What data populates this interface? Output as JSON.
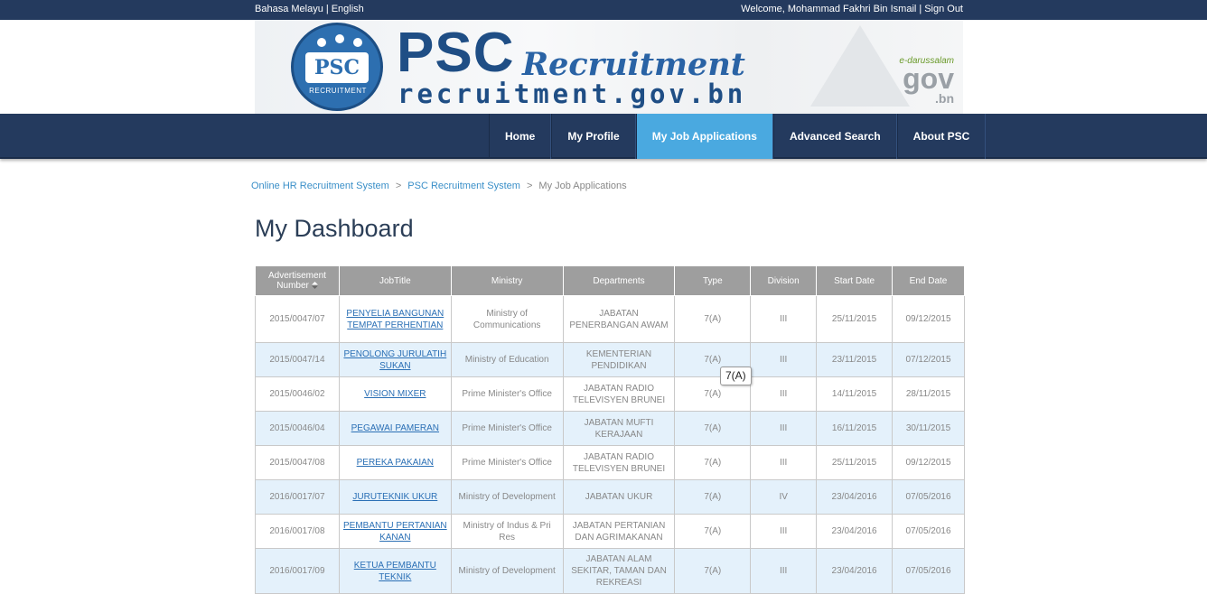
{
  "topbar": {
    "lang_malay": "Bahasa Melayu",
    "lang_english": "English",
    "welcome": "Welcome, Mohammad Fakhri Bin Ismail",
    "sign_out": "Sign Out"
  },
  "banner": {
    "logo_box": "PSC",
    "logo_sub": "RECRUITMENT",
    "title_psc": "PSC",
    "title_recruitment": "Recruitment",
    "url": "recruitment.gov.bn",
    "gov_ed": "e-darussalam",
    "gov_gov": "gov",
    "gov_bn": ".bn"
  },
  "nav": {
    "items": [
      {
        "label": "Home"
      },
      {
        "label": "My Profile"
      },
      {
        "label": "My Job Applications"
      },
      {
        "label": "Advanced Search"
      },
      {
        "label": "About PSC"
      }
    ]
  },
  "breadcrumb": {
    "items": [
      "Online HR Recruitment System",
      "PSC Recruitment System",
      "My Job Applications"
    ]
  },
  "page_title": "My Dashboard",
  "table": {
    "headers": [
      "Advertisement Number",
      "JobTitle",
      "Ministry",
      "Departments",
      "Type",
      "Division",
      "Start Date",
      "End Date"
    ],
    "rows": [
      [
        "2015/0047/07",
        "PENYELIA BANGUNAN TEMPAT PERHENTIAN",
        "Ministry of Communications",
        "JABATAN PENERBANGAN AWAM",
        "7(A)",
        "III",
        "25/11/2015",
        "09/12/2015"
      ],
      [
        "2015/0047/14",
        "PENOLONG JURULATIH SUKAN",
        "Ministry of Education",
        "KEMENTERIAN PENDIDIKAN",
        "7(A)",
        "III",
        "23/11/2015",
        "07/12/2015"
      ],
      [
        "2015/0046/02",
        "VISION MIXER",
        "Prime Minister's Office",
        "JABATAN RADIO TELEVISYEN BRUNEI",
        "7(A)",
        "III",
        "14/11/2015",
        "28/11/2015"
      ],
      [
        "2015/0046/04",
        "PEGAWAI PAMERAN",
        "Prime Minister's Office",
        "JABATAN MUFTI KERAJAAN",
        "7(A)",
        "III",
        "16/11/2015",
        "30/11/2015"
      ],
      [
        "2015/0047/08",
        "PEREKA PAKAIAN",
        "Prime Minister's Office",
        "JABATAN RADIO TELEVISYEN BRUNEI",
        "7(A)",
        "III",
        "25/11/2015",
        "09/12/2015"
      ],
      [
        "2016/0017/07",
        "JURUTEKNIK UKUR",
        "Ministry of Development",
        "JABATAN UKUR",
        "7(A)",
        "IV",
        "23/04/2016",
        "07/05/2016"
      ],
      [
        "2016/0017/08",
        "PEMBANTU PERTANIAN KANAN",
        "Ministry of Indus & Pri Res",
        "JABATAN PERTANIAN DAN AGRIMAKANAN",
        "7(A)",
        "III",
        "23/04/2016",
        "07/05/2016"
      ],
      [
        "2016/0017/09",
        "KETUA PEMBANTU TEKNIK",
        "Ministry of Development",
        "JABATAN ALAM SEKITAR, TAMAN DAN REKREASI",
        "7(A)",
        "III",
        "23/04/2016",
        "07/05/2016"
      ]
    ]
  },
  "tooltip": "7(A)",
  "colors": {
    "topbar": "#243a5e",
    "nav_active": "#4aa9e0",
    "link": "#2a6fb5",
    "row_alt": "#e4f1fb",
    "header": "#9e9e9e"
  }
}
